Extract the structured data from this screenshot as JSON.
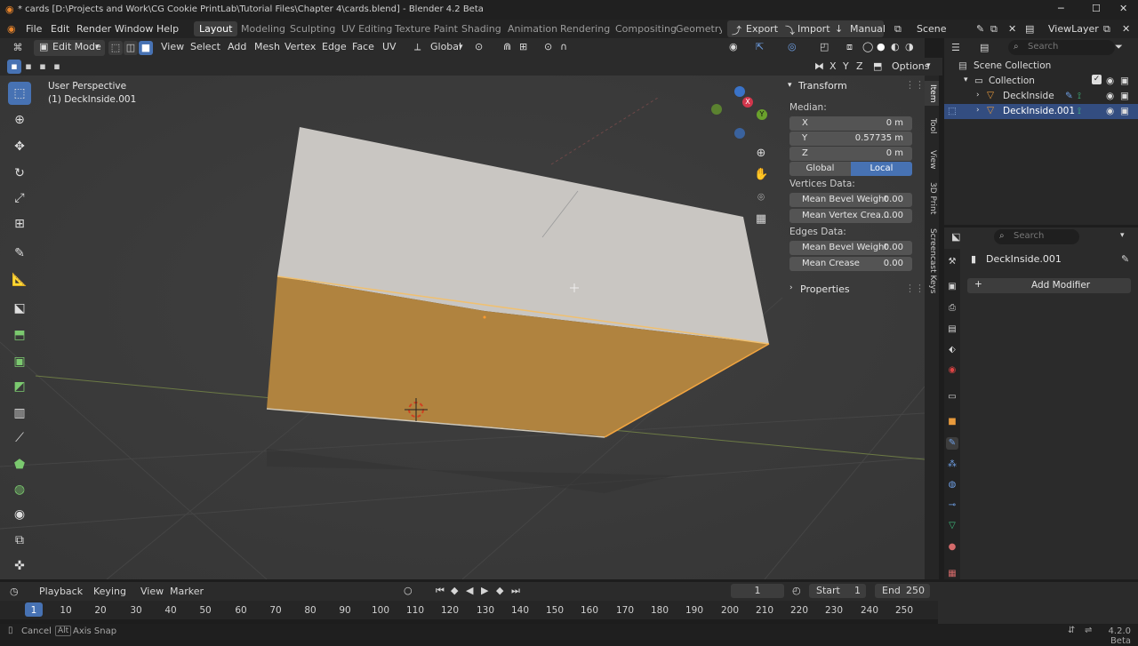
{
  "app": {
    "title": "* cards [D:\\Projects and Work\\CG Cookie PrintLab\\Tutorial Files\\Chapter 4\\cards.blend] - Blender 4.2 Beta"
  },
  "window_controls": {
    "minimize": "─",
    "maximize": "☐",
    "close": "✕"
  },
  "menu": {
    "items": [
      "File",
      "Edit",
      "Render",
      "Window",
      "Help"
    ]
  },
  "workspaces": [
    "Layout",
    "Modeling",
    "Sculpting",
    "UV Editing",
    "Texture Paint",
    "Shading",
    "Animation",
    "Rendering",
    "Compositing",
    "Geometry N"
  ],
  "top_right": {
    "export": "Export",
    "import": "Import",
    "manual": "Manual",
    "scene": "Scene",
    "view_layer": "ViewLayer"
  },
  "header": {
    "mode": "Edit Mode",
    "menus": [
      "View",
      "Select",
      "Add",
      "Mesh",
      "Vertex",
      "Edge",
      "Face",
      "UV"
    ],
    "orientation": "Global",
    "xyz": [
      "X",
      "Y",
      "Z"
    ],
    "options": "Options"
  },
  "viewport": {
    "perspective": "User Perspective",
    "object": "(1) DeckInside.001"
  },
  "gizmo": {
    "x": "X",
    "y": "Y",
    "z": "Z"
  },
  "npanel": {
    "transform": "Transform",
    "median": "Median:",
    "x_label": "X",
    "x_value": "0 m",
    "y_label": "Y",
    "y_value": "0.57735 m",
    "z_label": "Z",
    "z_value": "0 m",
    "global": "Global",
    "local": "Local",
    "vertices_data": "Vertices Data:",
    "mean_bevel_weight_v": "Mean Bevel Weight",
    "mean_bevel_weight_v_val": "0.00",
    "mean_vertex_crease": "Mean Vertex Crea...",
    "mean_vertex_crease_val": "0.00",
    "edges_data": "Edges Data:",
    "mean_bevel_weight_e": "Mean Bevel Weight",
    "mean_bevel_weight_e_val": "0.00",
    "mean_crease": "Mean Crease",
    "mean_crease_val": "0.00",
    "properties": "Properties"
  },
  "side_tabs": [
    "Item",
    "Tool",
    "View",
    "3D Print",
    "Screencast Keys"
  ],
  "outliner": {
    "search_placeholder": "Search",
    "scene_collection": "Scene Collection",
    "collection": "Collection",
    "objects": [
      "DeckInside",
      "DeckInside.001"
    ]
  },
  "properties_panel": {
    "search_placeholder": "Search",
    "object_name": "DeckInside.001",
    "add_modifier": "Add Modifier"
  },
  "timeline": {
    "menus": [
      "Playback",
      "Keying",
      "View",
      "Marker"
    ],
    "current_frame": "1",
    "start_label": "Start",
    "start": "1",
    "end_label": "End",
    "end": "250",
    "ticks": [
      "1",
      "10",
      "20",
      "30",
      "40",
      "50",
      "60",
      "70",
      "80",
      "90",
      "100",
      "110",
      "120",
      "130",
      "140",
      "150",
      "160",
      "170",
      "180",
      "190",
      "200",
      "210",
      "220",
      "230",
      "240",
      "250"
    ]
  },
  "status": {
    "cancel": "Cancel",
    "alt": "Alt",
    "axis_snap": "Axis Snap",
    "version": "4.2.0 Beta"
  },
  "colors": {
    "accent": "#4772b3",
    "face_top": "#c9c6c2",
    "face_front": "#b0833f",
    "viewport_bg": "#3a3a3a",
    "selected_row": "#334d80"
  }
}
